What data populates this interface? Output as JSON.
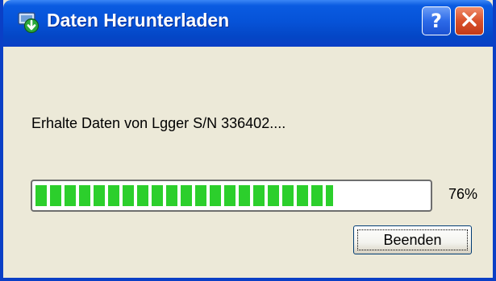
{
  "window": {
    "title": "Daten Herunterladen",
    "icons": {
      "app": "download-icon",
      "help": "help-icon",
      "close": "close-icon"
    },
    "help_label": "?"
  },
  "dialog": {
    "message": "Erhalte Daten von Lgger S/N 336402....",
    "progress": {
      "percent": 76,
      "label": "76%"
    },
    "cancel_button_label": "Beenden"
  },
  "colors": {
    "titlebar": "#0653d8",
    "body": "#ece9d8",
    "progress_fill": "#2ccf2c"
  }
}
